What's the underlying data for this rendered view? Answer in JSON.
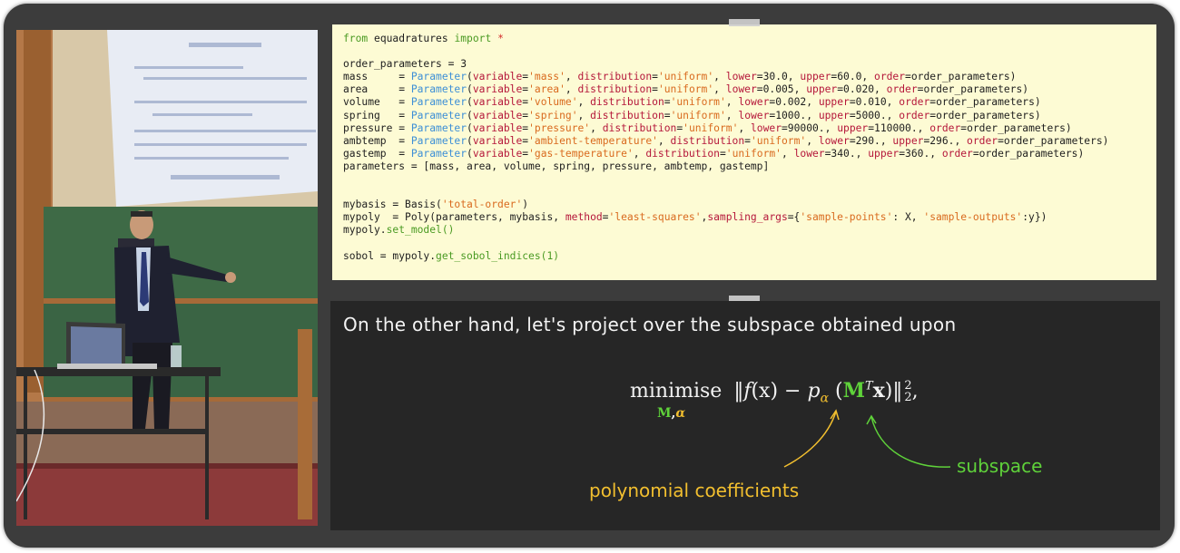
{
  "code": {
    "lines": [
      [
        {
          "t": "from",
          "c": "k"
        },
        {
          "t": " equadratures "
        },
        {
          "t": "import",
          "c": "k"
        },
        {
          "t": " "
        },
        {
          "t": "*",
          "c": "star"
        }
      ],
      [],
      [
        {
          "t": "order_parameters = 3"
        }
      ],
      [
        {
          "t": "mass     = "
        },
        {
          "t": "Parameter",
          "c": "cls"
        },
        {
          "t": "("
        },
        {
          "t": "variable",
          "c": "arg"
        },
        {
          "t": "="
        },
        {
          "t": "'mass'",
          "c": "str"
        },
        {
          "t": ", "
        },
        {
          "t": "distribution",
          "c": "arg"
        },
        {
          "t": "="
        },
        {
          "t": "'uniform'",
          "c": "str"
        },
        {
          "t": ", "
        },
        {
          "t": "lower",
          "c": "arg"
        },
        {
          "t": "=30.0, "
        },
        {
          "t": "upper",
          "c": "arg"
        },
        {
          "t": "=60.0, "
        },
        {
          "t": "order",
          "c": "arg"
        },
        {
          "t": "=order_parameters)"
        }
      ],
      [
        {
          "t": "area     = "
        },
        {
          "t": "Parameter",
          "c": "cls"
        },
        {
          "t": "("
        },
        {
          "t": "variable",
          "c": "arg"
        },
        {
          "t": "="
        },
        {
          "t": "'area'",
          "c": "str"
        },
        {
          "t": ", "
        },
        {
          "t": "distribution",
          "c": "arg"
        },
        {
          "t": "="
        },
        {
          "t": "'uniform'",
          "c": "str"
        },
        {
          "t": ", "
        },
        {
          "t": "lower",
          "c": "arg"
        },
        {
          "t": "=0.005, "
        },
        {
          "t": "upper",
          "c": "arg"
        },
        {
          "t": "=0.020, "
        },
        {
          "t": "order",
          "c": "arg"
        },
        {
          "t": "=order_parameters)"
        }
      ],
      [
        {
          "t": "volume   = "
        },
        {
          "t": "Parameter",
          "c": "cls"
        },
        {
          "t": "("
        },
        {
          "t": "variable",
          "c": "arg"
        },
        {
          "t": "="
        },
        {
          "t": "'volume'",
          "c": "str"
        },
        {
          "t": ", "
        },
        {
          "t": "distribution",
          "c": "arg"
        },
        {
          "t": "="
        },
        {
          "t": "'uniform'",
          "c": "str"
        },
        {
          "t": ", "
        },
        {
          "t": "lower",
          "c": "arg"
        },
        {
          "t": "=0.002, "
        },
        {
          "t": "upper",
          "c": "arg"
        },
        {
          "t": "=0.010, "
        },
        {
          "t": "order",
          "c": "arg"
        },
        {
          "t": "=order_parameters)"
        }
      ],
      [
        {
          "t": "spring   = "
        },
        {
          "t": "Parameter",
          "c": "cls"
        },
        {
          "t": "("
        },
        {
          "t": "variable",
          "c": "arg"
        },
        {
          "t": "="
        },
        {
          "t": "'spring'",
          "c": "str"
        },
        {
          "t": ", "
        },
        {
          "t": "distribution",
          "c": "arg"
        },
        {
          "t": "="
        },
        {
          "t": "'uniform'",
          "c": "str"
        },
        {
          "t": ", "
        },
        {
          "t": "lower",
          "c": "arg"
        },
        {
          "t": "=1000., "
        },
        {
          "t": "upper",
          "c": "arg"
        },
        {
          "t": "=5000., "
        },
        {
          "t": "order",
          "c": "arg"
        },
        {
          "t": "=order_parameters)"
        }
      ],
      [
        {
          "t": "pressure = "
        },
        {
          "t": "Parameter",
          "c": "cls"
        },
        {
          "t": "("
        },
        {
          "t": "variable",
          "c": "arg"
        },
        {
          "t": "="
        },
        {
          "t": "'pressure'",
          "c": "str"
        },
        {
          "t": ", "
        },
        {
          "t": "distribution",
          "c": "arg"
        },
        {
          "t": "="
        },
        {
          "t": "'uniform'",
          "c": "str"
        },
        {
          "t": ", "
        },
        {
          "t": "lower",
          "c": "arg"
        },
        {
          "t": "=90000., "
        },
        {
          "t": "upper",
          "c": "arg"
        },
        {
          "t": "=110000., "
        },
        {
          "t": "order",
          "c": "arg"
        },
        {
          "t": "=order_parameters)"
        }
      ],
      [
        {
          "t": "ambtemp  = "
        },
        {
          "t": "Parameter",
          "c": "cls"
        },
        {
          "t": "("
        },
        {
          "t": "variable",
          "c": "arg"
        },
        {
          "t": "="
        },
        {
          "t": "'ambient-temperature'",
          "c": "str"
        },
        {
          "t": ", "
        },
        {
          "t": "distribution",
          "c": "arg"
        },
        {
          "t": "="
        },
        {
          "t": "'uniform'",
          "c": "str"
        },
        {
          "t": ", "
        },
        {
          "t": "lower",
          "c": "arg"
        },
        {
          "t": "=290., "
        },
        {
          "t": "upper",
          "c": "arg"
        },
        {
          "t": "=296., "
        },
        {
          "t": "order",
          "c": "arg"
        },
        {
          "t": "=order_parameters)"
        }
      ],
      [
        {
          "t": "gastemp  = "
        },
        {
          "t": "Parameter",
          "c": "cls"
        },
        {
          "t": "("
        },
        {
          "t": "variable",
          "c": "arg"
        },
        {
          "t": "="
        },
        {
          "t": "'gas-temperature'",
          "c": "str"
        },
        {
          "t": ", "
        },
        {
          "t": "distribution",
          "c": "arg"
        },
        {
          "t": "="
        },
        {
          "t": "'uniform'",
          "c": "str"
        },
        {
          "t": ", "
        },
        {
          "t": "lower",
          "c": "arg"
        },
        {
          "t": "=340., "
        },
        {
          "t": "upper",
          "c": "arg"
        },
        {
          "t": "=360., "
        },
        {
          "t": "order",
          "c": "arg"
        },
        {
          "t": "=order_parameters)"
        }
      ],
      [
        {
          "t": "parameters = [mass, area, volume, spring, pressure, ambtemp, gastemp]"
        }
      ],
      [],
      [],
      [
        {
          "t": "mybasis = Basis("
        },
        {
          "t": "'total-order'",
          "c": "str"
        },
        {
          "t": ")"
        }
      ],
      [
        {
          "t": "mypoly  = Poly(parameters, mybasis, "
        },
        {
          "t": "method",
          "c": "arg"
        },
        {
          "t": "="
        },
        {
          "t": "'least-squares'",
          "c": "str"
        },
        {
          "t": ","
        },
        {
          "t": "sampling_args",
          "c": "arg"
        },
        {
          "t": "={"
        },
        {
          "t": "'sample-points'",
          "c": "str"
        },
        {
          "t": ": X, "
        },
        {
          "t": "'sample-outputs'",
          "c": "str"
        },
        {
          "t": ":y})"
        }
      ],
      [
        {
          "t": "mypoly."
        },
        {
          "t": "set_model()",
          "c": "k"
        }
      ],
      [],
      [
        {
          "t": "sobol = mypoly."
        },
        {
          "t": "get_sobol_indices(1)",
          "c": "k"
        }
      ]
    ]
  },
  "slide": {
    "headline": "On the other hand, let's project over the subspace obtained upon",
    "equation": {
      "op": "minimise",
      "under_M": "M",
      "under_sep": ",",
      "under_alpha": "α",
      "open_norm": "‖",
      "f": "f",
      "x_arg": "(x)",
      "minus": " − ",
      "p": "p",
      "alpha_sub": "α",
      "lparen": " (",
      "M": "M",
      "T": "T",
      "x": "x",
      "rparen": ")",
      "close_norm": "‖",
      "sup2": "2",
      "sub2": "2",
      "comma": ","
    },
    "label_subspace": "subspace",
    "label_coefficients": "polynomial coefficients"
  },
  "colors": {
    "green": "#5fd23a",
    "yellow": "#f2bf2f",
    "code_bg": "#fdfbd4",
    "panel_bg": "#262626"
  }
}
